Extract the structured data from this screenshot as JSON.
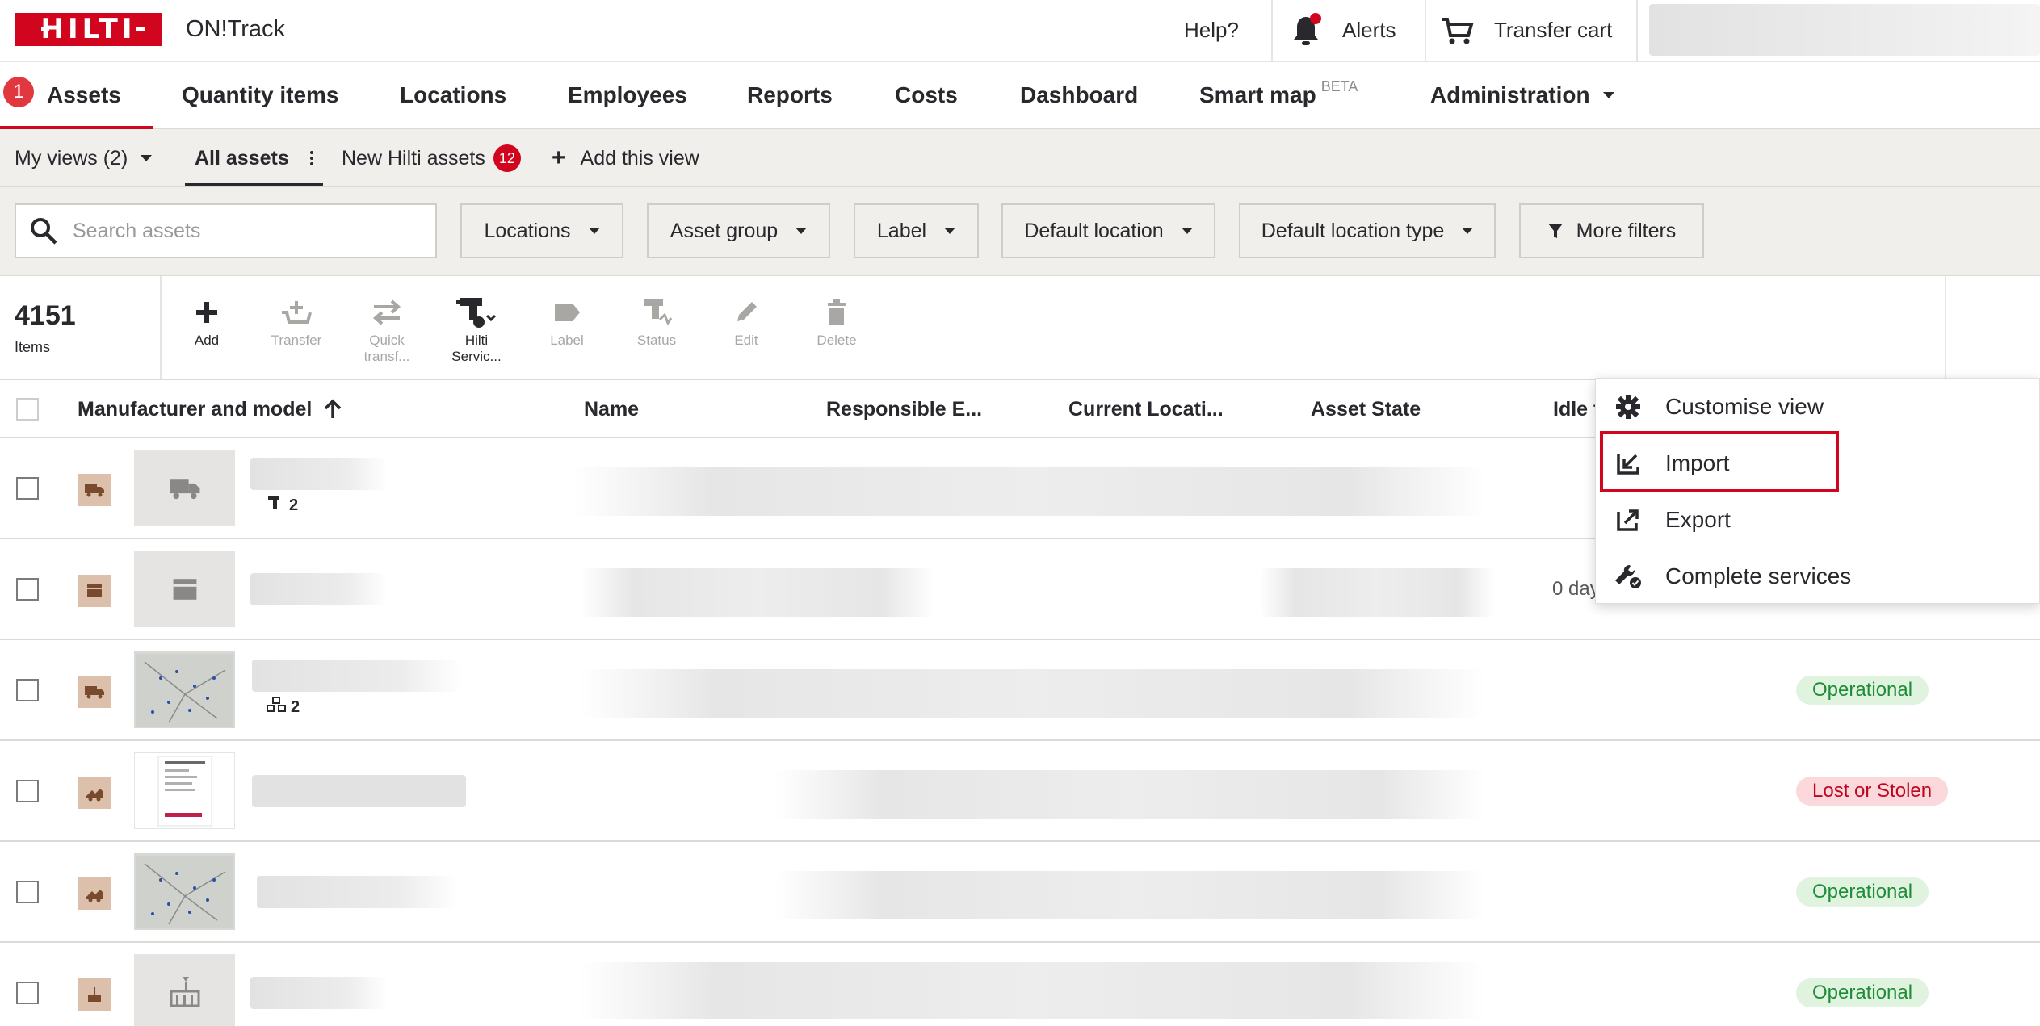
{
  "header": {
    "logo_text": "HILTI",
    "app_name": "ON!Track",
    "help": "Help?",
    "alerts": "Alerts",
    "transfer_cart": "Transfer cart"
  },
  "nav": {
    "step_badge": "1",
    "tabs": [
      {
        "label": "Assets"
      },
      {
        "label": "Quantity items"
      },
      {
        "label": "Locations"
      },
      {
        "label": "Employees"
      },
      {
        "label": "Reports"
      },
      {
        "label": "Costs"
      },
      {
        "label": "Dashboard"
      },
      {
        "label": "Smart map"
      },
      {
        "label": "Administration"
      }
    ],
    "beta": "BETA"
  },
  "views": {
    "my_views": "My views (2)",
    "all_assets": "All assets",
    "new_hilti_assets": "New Hilti assets",
    "new_count": "12",
    "add_view": "Add this view"
  },
  "filters": {
    "search_placeholder": "Search assets",
    "buttons": [
      "Locations",
      "Asset group",
      "Label",
      "Default location",
      "Default location type"
    ],
    "more_filters": "More filters"
  },
  "toolbar": {
    "count": "4151",
    "count_label": "Items",
    "actions": [
      {
        "label": "Add"
      },
      {
        "label": "Transfer"
      },
      {
        "label": "Quick transf..."
      },
      {
        "label": "Hilti Servic..."
      },
      {
        "label": "Label"
      },
      {
        "label": "Status"
      },
      {
        "label": "Edit"
      },
      {
        "label": "Delete"
      }
    ]
  },
  "table": {
    "columns": [
      "Manufacturer and model",
      "Name",
      "Responsible E...",
      "Current Locati...",
      "Asset State",
      "Idle t"
    ],
    "rows": [
      {
        "sub_count": "2",
        "idle": "",
        "status": ""
      },
      {
        "sub_count": "",
        "idle": "0 day",
        "status": ""
      },
      {
        "sub_count": "2",
        "idle": "",
        "status": "Operational"
      },
      {
        "sub_count": "",
        "idle": "",
        "status": "Lost or Stolen"
      },
      {
        "sub_count": "",
        "idle": "",
        "status": "Operational"
      },
      {
        "sub_count": "",
        "idle": "",
        "status": "Operational"
      }
    ]
  },
  "menu": {
    "items": [
      {
        "label": "Customise view"
      },
      {
        "label": "Import"
      },
      {
        "label": "Export"
      },
      {
        "label": "Complete services"
      }
    ]
  },
  "colors": {
    "brand": "#d2051e",
    "operational_bg": "#dff3df",
    "lost_bg": "#fbd8dc"
  }
}
